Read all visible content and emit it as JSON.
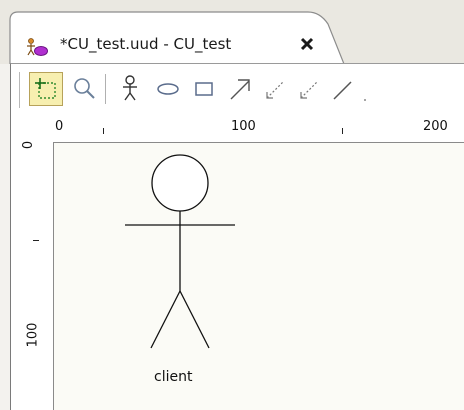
{
  "editor_tab": {
    "title": "*CU_test.uud - CU_test",
    "icon": "use-case-diagram-icon",
    "close_icon": "close-icon"
  },
  "toolbar": {
    "tools": [
      {
        "name": "select-tool",
        "icon": "select-marquee-icon",
        "selected": true
      },
      {
        "name": "zoom-tool",
        "icon": "magnifier-icon"
      },
      {
        "name": "actor-tool",
        "icon": "actor-icon"
      },
      {
        "name": "use-case-tool",
        "icon": "ellipse-icon"
      },
      {
        "name": "system-boundary-tool",
        "icon": "rectangle-icon"
      },
      {
        "name": "generalization-tool",
        "icon": "generalization-arrow-icon"
      },
      {
        "name": "include-tool",
        "icon": "dashed-dependency-icon"
      },
      {
        "name": "extend-tool",
        "icon": "dashed-dependency-icon"
      },
      {
        "name": "association-tool",
        "icon": "line-icon"
      }
    ]
  },
  "rulers": {
    "horizontal": {
      "labels": [
        "0",
        "100",
        "200"
      ]
    },
    "vertical": {
      "labels": [
        "0",
        "100"
      ]
    }
  },
  "diagram": {
    "actors": [
      {
        "label": "client"
      }
    ]
  }
}
